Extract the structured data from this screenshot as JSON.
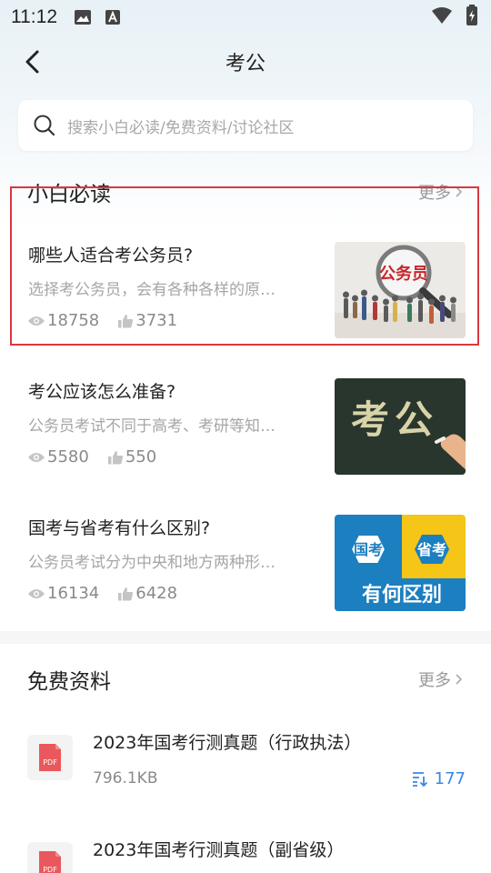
{
  "status_bar": {
    "time": "11:12"
  },
  "header": {
    "title": "考公"
  },
  "search": {
    "placeholder": "搜索小白必读/免费资料/讨论社区"
  },
  "section_guide": {
    "title": "小白必读",
    "more": "更多",
    "articles": [
      {
        "title": "哪些人适合考公务员?",
        "summary": "选择考公务员，会有各种各样的原…",
        "views": "18758",
        "likes": "3731",
        "thumb_text": "公务员"
      },
      {
        "title": "考公应该怎么准备?",
        "summary": "公务员考试不同于高考、考研等知…",
        "views": "5580",
        "likes": "550",
        "thumb_text": "考公"
      },
      {
        "title": "国考与省考有什么区别?",
        "summary": "公务员考试分为中央和地方两种形…",
        "views": "16134",
        "likes": "6428",
        "thumb_text_left": "国考",
        "thumb_text_right": "省考",
        "thumb_text_bottom": "有何区别"
      }
    ]
  },
  "section_files": {
    "title": "免费资料",
    "more": "更多",
    "files": [
      {
        "title": "2023年国考行测真题（行政执法）",
        "size": "796.1KB",
        "downloads": "177",
        "icon_label": "PDF"
      },
      {
        "title": "2023年国考行测真题（副省级）",
        "icon_label": "PDF"
      }
    ]
  },
  "colors": {
    "highlight": "#d9383f",
    "accent_blue": "#3a86e6",
    "pdf_red": "#e9585c"
  }
}
